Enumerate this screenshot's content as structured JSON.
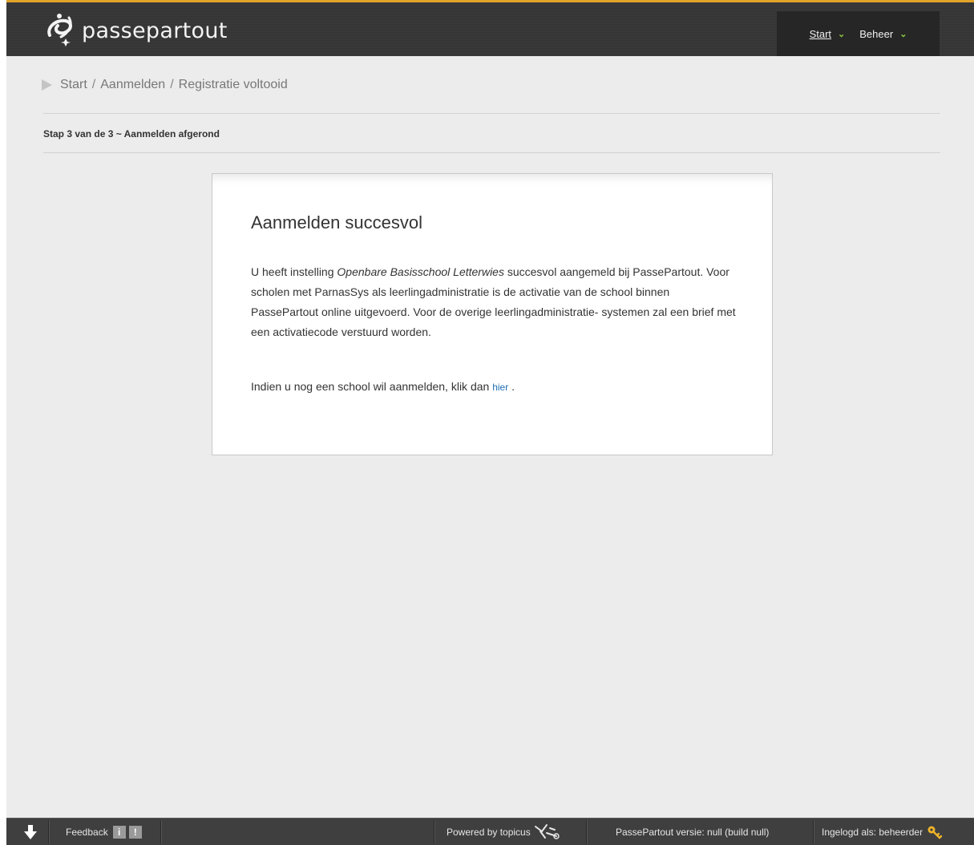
{
  "header": {
    "logo_text": "passepartout",
    "logo_icon": "passepartout-swirl-logo",
    "accent_color": "#e3a32b",
    "nav": [
      {
        "label": "Start",
        "icon": "chevron-down-icon"
      },
      {
        "label": "Beheer",
        "icon": "chevron-down-icon"
      }
    ],
    "chevron_glyph": "⌄",
    "chevron_color": "#8cc63f"
  },
  "breadcrumb": {
    "items": [
      "Start",
      "Aanmelden",
      "Registratie voltooid"
    ],
    "separator": "/"
  },
  "step_title": "Stap 3 van de 3 ~ Aanmelden afgerond",
  "panel": {
    "title": "Aanmelden succesvol",
    "para_before_school": "U heeft instelling",
    "school_name": "Openbare Basisschool Letterwies",
    "para_after_school": "succesvol aangemeld bij PassePartout. Voor scholen met ParnasSys als leerlingadministratie is de activatie van de school binnen PassePartout online uitgevoerd. Voor de overige leerlingadministratie- systemen zal een brief met een activatiecode verstuurd worden.",
    "again_text": "Indien u nog een school wil aanmelden, klik dan",
    "link_text": "hier",
    "again_suffix": ".",
    "link_color": "#1e6fb4"
  },
  "footer": {
    "feedback_label": "Feedback",
    "info_button": "i",
    "alert_button": "!",
    "powered_by": "Powered by topicus",
    "version": "PassePartout versie: null (build null)",
    "logged_in": "Ingelogd als: beheerder"
  }
}
